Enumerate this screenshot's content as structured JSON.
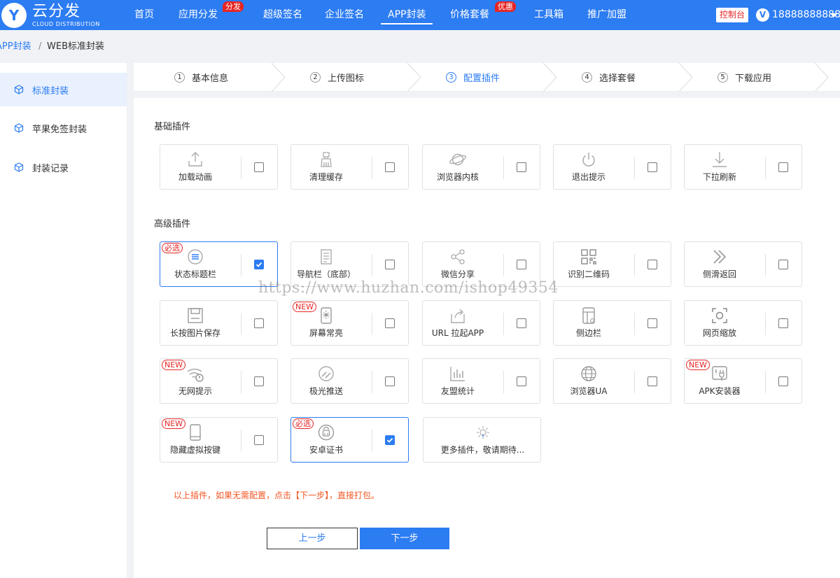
{
  "header": {
    "logo_letter": "Y",
    "brand_name": "云分发",
    "brand_sub": "CLOUD DISTRIBUTION",
    "nav": [
      {
        "label": "首页"
      },
      {
        "label": "应用分发",
        "badge": "分发"
      },
      {
        "label": "超级签名"
      },
      {
        "label": "企业签名"
      },
      {
        "label": "APP封装",
        "active": true
      },
      {
        "label": "价格套餐",
        "badge": "优惠"
      },
      {
        "label": "工具箱"
      },
      {
        "label": "推广加盟"
      }
    ],
    "console_label": "控制台",
    "avatar_letter": "V",
    "user_name": "18888888888"
  },
  "breadcrumb": {
    "parent": "APP封装",
    "separator": "/",
    "current": "WEB标准封装"
  },
  "sidebar": {
    "items": [
      {
        "label": "标准封装",
        "active": true
      },
      {
        "label": "苹果免签封装"
      },
      {
        "label": "封装记录"
      }
    ]
  },
  "steps": [
    {
      "num": "1",
      "label": "基本信息"
    },
    {
      "num": "2",
      "label": "上传图标"
    },
    {
      "num": "3",
      "label": "配置插件",
      "active": true
    },
    {
      "num": "4",
      "label": "选择套餐"
    },
    {
      "num": "5",
      "label": "下载应用"
    }
  ],
  "basic_title": "基础插件",
  "basic_plugins": [
    {
      "label": "加载动画",
      "icon": "upload-icon",
      "checked": false
    },
    {
      "label": "清理缓存",
      "icon": "brush-icon",
      "checked": false
    },
    {
      "label": "浏览器内核",
      "icon": "planet-icon",
      "checked": false
    },
    {
      "label": "退出提示",
      "icon": "power-icon",
      "checked": false
    },
    {
      "label": "下拉刷新",
      "icon": "download-arrow-icon",
      "checked": false
    }
  ],
  "advanced_title": "高级插件",
  "advanced_plugins": [
    {
      "label": "状态标题栏",
      "icon": "list-circle-icon",
      "checked": true,
      "tag": "必选"
    },
    {
      "label": "导航栏（底部）",
      "icon": "document-icon",
      "checked": false
    },
    {
      "label": "微信分享",
      "icon": "share-icon",
      "checked": false
    },
    {
      "label": "识别二维码",
      "icon": "qr-code-icon",
      "checked": false
    },
    {
      "label": "侧滑返回",
      "icon": "double-chevron-icon",
      "checked": false
    },
    {
      "label": "长按图片保存",
      "icon": "save-icon",
      "checked": false
    },
    {
      "label": "屏幕常亮",
      "icon": "phone-sun-icon",
      "checked": false,
      "tag": "NEW"
    },
    {
      "label": "URL 拉起APP",
      "icon": "launch-icon",
      "checked": false
    },
    {
      "label": "侧边栏",
      "icon": "sidebar-device-icon",
      "checked": false
    },
    {
      "label": "网页缩放",
      "icon": "zoom-frame-icon",
      "checked": false
    },
    {
      "label": "无网提示",
      "icon": "wifi-alert-icon",
      "checked": false,
      "tag": "NEW"
    },
    {
      "label": "极光推送",
      "icon": "push-icon",
      "checked": false
    },
    {
      "label": "友盟统计",
      "icon": "bar-chart-icon",
      "checked": false
    },
    {
      "label": "浏览器UA",
      "icon": "globe-icon",
      "checked": false
    },
    {
      "label": "APK安装器",
      "icon": "apk-plug-icon",
      "checked": false,
      "tag": "NEW"
    },
    {
      "label": "隐藏虚拟按键",
      "icon": "phone-icon",
      "checked": false,
      "tag": "NEW"
    },
    {
      "label": "安卓证书",
      "icon": "android-icon",
      "checked": true,
      "tag": "必选"
    }
  ],
  "more_plugins_label": "更多插件，敬请期待...",
  "notice": "以上插件，如果无需配置，点击【下一步】，直接打包。",
  "buttons": {
    "prev": "上一步",
    "next": "下一步"
  },
  "watermark": "https://www.huzhan.com/ishop49354",
  "colors": {
    "primary": "#2c7cf2",
    "badge": "#e62525",
    "notice": "#f25623"
  }
}
